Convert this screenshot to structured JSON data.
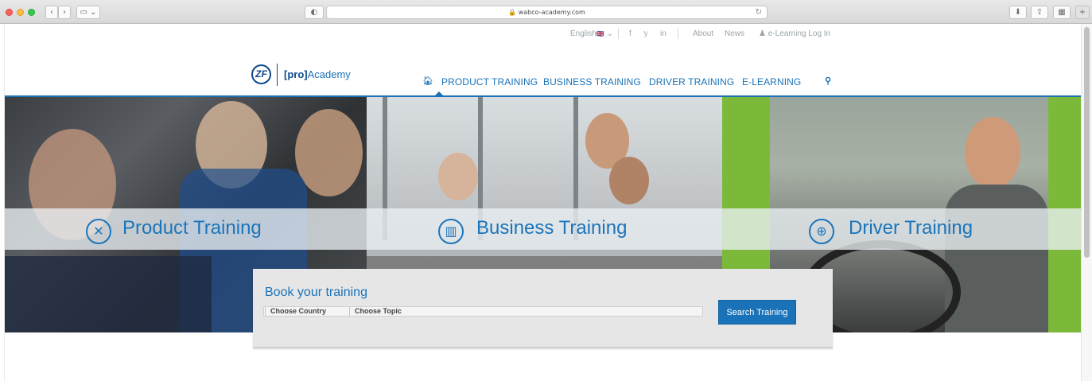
{
  "browser": {
    "url": "wabco-academy.com",
    "shield_glyph": "◐"
  },
  "topbar": {
    "language": "English",
    "language_flag": "🇬🇧",
    "caret": "⌄",
    "social": [
      "f",
      "𝕪",
      "in"
    ],
    "about": "About",
    "news": "News",
    "elearning_login": "e-Learning Log In"
  },
  "logo": {
    "mark": "ZF",
    "bracket_text": "[pro]",
    "academy_text": "Academy"
  },
  "nav": {
    "items": [
      "PRODUCT TRAINING",
      "BUSINESS TRAINING",
      "DRIVER TRAINING",
      "E-LEARNING"
    ]
  },
  "hero": {
    "product_training": "Product Training",
    "business_training": "Business Training",
    "driver_training": "Driver Training"
  },
  "booking": {
    "title": "Book your training",
    "choose_country": "Choose Country",
    "choose_topic": "Choose Topic",
    "search_button": "Search Training"
  },
  "colors": {
    "brand_blue": "#1a73b8",
    "dark_blue": "#0e4a8a"
  }
}
